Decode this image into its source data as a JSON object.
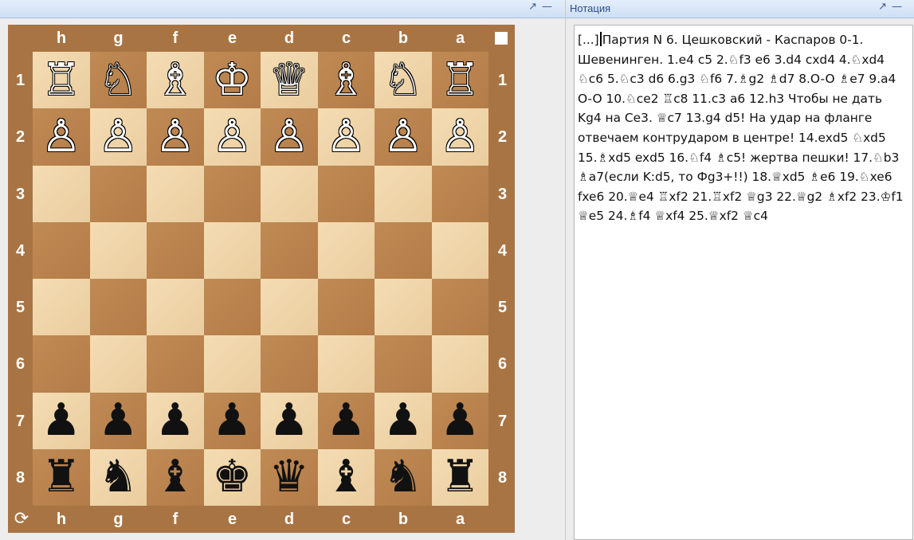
{
  "panels": {
    "left": {
      "buttons": {
        "float": "↗",
        "minimize": "—"
      }
    },
    "right": {
      "title": "Нотация",
      "buttons": {
        "float": "↗",
        "minimize": "—"
      }
    }
  },
  "board": {
    "files": [
      "h",
      "g",
      "f",
      "e",
      "d",
      "c",
      "b",
      "a"
    ],
    "ranks": [
      "1",
      "2",
      "3",
      "4",
      "5",
      "6",
      "7",
      "8"
    ],
    "rows": [
      [
        "♖",
        "♘",
        "♗",
        "♔",
        "♕",
        "♗",
        "♘",
        "♖"
      ],
      [
        "♙",
        "♙",
        "♙",
        "♙",
        "♙",
        "♙",
        "♙",
        "♙"
      ],
      [
        "",
        "",
        "",
        "",
        "",
        "",
        "",
        ""
      ],
      [
        "",
        "",
        "",
        "",
        "",
        "",
        "",
        ""
      ],
      [
        "",
        "",
        "",
        "",
        "",
        "",
        "",
        ""
      ],
      [
        "",
        "",
        "",
        "",
        "",
        "",
        "",
        ""
      ],
      [
        "♟",
        "♟",
        "♟",
        "♟",
        "♟",
        "♟",
        "♟",
        "♟"
      ],
      [
        "♜",
        "♞",
        "♝",
        "♚",
        "♛",
        "♝",
        "♞",
        "♜"
      ]
    ],
    "flip_icon": "refresh-icon",
    "colors": {
      "frame": "#a97443",
      "light": "#f0d6aa",
      "dark": "#b9824d"
    }
  },
  "notation": {
    "prefix": "[...]",
    "text": "Партия N 6. Цешковский - Каспаров 0-1. Шевенинген. 1.e4 c5 2.♘f3 e6 3.d4 cxd4 4.♘xd4 ♘c6 5.♘c3 d6 6.g3 ♘f6 7.♗g2 ♗d7 8.O-O ♗e7 9.a4 O-O 10.♘ce2 ♖c8 11.c3 a6 12.h3  Чтобы не дать Kg4 на Ce3. ♕c7 13.g4 d5!  На удар на фланге отвечаем контрударом в центре! 14.exd5 ♘xd5 15.♗xd5 exd5 16.♘f4 ♗c5! жертва пешки! 17.♘b3 ♗a7(если K:d5, то Фg3+!!) 18.♕xd5 ♗e6 19.♘xe6 fxe6 20.♕e4 ♖xf2 21.♖xf2 ♕g3 22.♕g2 ♗xf2 23.♔f1 ♕e5 24.♗f4 ♕xf4 25.♕xf2 ♕c4"
  }
}
